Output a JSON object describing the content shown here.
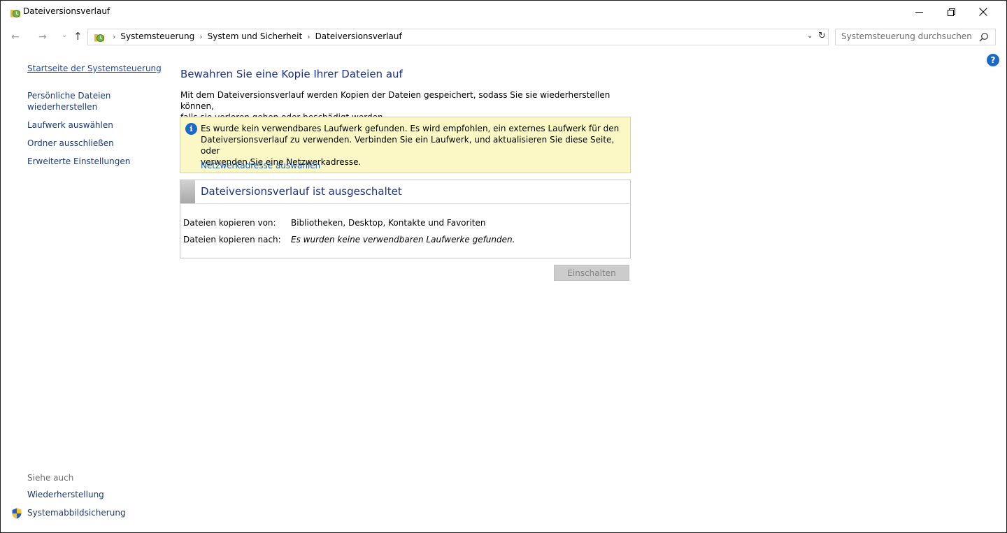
{
  "window": {
    "title": "Dateiversionsverlauf",
    "icon": "file-history-icon"
  },
  "address": {
    "breadcrumbs": [
      "Systemsteuerung",
      "System und Sicherheit",
      "Dateiversionsverlauf"
    ],
    "search_placeholder": "Systemsteuerung durchsuchen"
  },
  "leftnav": {
    "home": "Startseite der Systemsteuerung",
    "items": [
      "Persönliche Dateien",
      "wiederherstellen",
      "Laufwerk auswählen",
      "Ordner ausschließen",
      "Erweiterte Einstellungen"
    ]
  },
  "see_also": {
    "heading": "Siehe auch",
    "links": [
      "Wiederherstellung",
      "Systemabbildsicherung"
    ]
  },
  "main": {
    "title": "Bewahren Sie eine Kopie Ihrer Dateien auf",
    "description_1": "Mit dem Dateiversionsverlauf werden Kopien der Dateien gespeichert, sodass Sie sie wiederherstellen können,",
    "description_2": "falls sie verloren gehen oder beschädigt werden.",
    "warning": {
      "line_1": "Es wurde kein verwendbares Laufwerk gefunden. Es wird empfohlen, ein externes Laufwerk für den",
      "line_2": "Dateiversionsverlauf zu verwenden. Verbinden Sie ein Laufwerk, und aktualisieren Sie diese Seite, oder",
      "line_3": "verwenden Sie eine Netzwerkadresse.",
      "link": "Netzwerkadresse auswählen"
    },
    "status": {
      "title": "Dateiversionsverlauf ist ausgeschaltet",
      "copy_from_label": "Dateien kopieren von:",
      "copy_from_value": "Bibliotheken, Desktop, Kontakte und Favoriten",
      "copy_to_label": "Dateien kopieren nach:",
      "copy_to_value": "Es wurden keine verwendbaren Laufwerke gefunden."
    },
    "button_on": "Einschalten"
  },
  "colors": {
    "link": "#1c3b75",
    "title": "#1e3287",
    "warning_bg": "#fbf8c6"
  }
}
